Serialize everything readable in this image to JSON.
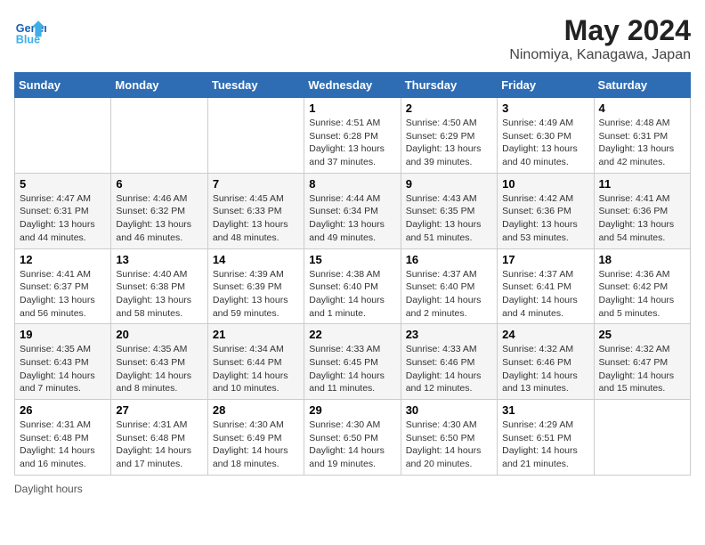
{
  "app": {
    "logo_line1": "General",
    "logo_line2": "Blue"
  },
  "header": {
    "title": "May 2024",
    "subtitle": "Ninomiya, Kanagawa, Japan"
  },
  "columns": [
    "Sunday",
    "Monday",
    "Tuesday",
    "Wednesday",
    "Thursday",
    "Friday",
    "Saturday"
  ],
  "footer": {
    "daylight_label": "Daylight hours"
  },
  "weeks": [
    {
      "days": [
        {
          "num": "",
          "sunrise": "",
          "sunset": "",
          "daylight": "",
          "empty": true
        },
        {
          "num": "",
          "sunrise": "",
          "sunset": "",
          "daylight": "",
          "empty": true
        },
        {
          "num": "",
          "sunrise": "",
          "sunset": "",
          "daylight": "",
          "empty": true
        },
        {
          "num": "1",
          "sunrise": "Sunrise: 4:51 AM",
          "sunset": "Sunset: 6:28 PM",
          "daylight": "Daylight: 13 hours and 37 minutes."
        },
        {
          "num": "2",
          "sunrise": "Sunrise: 4:50 AM",
          "sunset": "Sunset: 6:29 PM",
          "daylight": "Daylight: 13 hours and 39 minutes."
        },
        {
          "num": "3",
          "sunrise": "Sunrise: 4:49 AM",
          "sunset": "Sunset: 6:30 PM",
          "daylight": "Daylight: 13 hours and 40 minutes."
        },
        {
          "num": "4",
          "sunrise": "Sunrise: 4:48 AM",
          "sunset": "Sunset: 6:31 PM",
          "daylight": "Daylight: 13 hours and 42 minutes."
        }
      ]
    },
    {
      "days": [
        {
          "num": "5",
          "sunrise": "Sunrise: 4:47 AM",
          "sunset": "Sunset: 6:31 PM",
          "daylight": "Daylight: 13 hours and 44 minutes."
        },
        {
          "num": "6",
          "sunrise": "Sunrise: 4:46 AM",
          "sunset": "Sunset: 6:32 PM",
          "daylight": "Daylight: 13 hours and 46 minutes."
        },
        {
          "num": "7",
          "sunrise": "Sunrise: 4:45 AM",
          "sunset": "Sunset: 6:33 PM",
          "daylight": "Daylight: 13 hours and 48 minutes."
        },
        {
          "num": "8",
          "sunrise": "Sunrise: 4:44 AM",
          "sunset": "Sunset: 6:34 PM",
          "daylight": "Daylight: 13 hours and 49 minutes."
        },
        {
          "num": "9",
          "sunrise": "Sunrise: 4:43 AM",
          "sunset": "Sunset: 6:35 PM",
          "daylight": "Daylight: 13 hours and 51 minutes."
        },
        {
          "num": "10",
          "sunrise": "Sunrise: 4:42 AM",
          "sunset": "Sunset: 6:36 PM",
          "daylight": "Daylight: 13 hours and 53 minutes."
        },
        {
          "num": "11",
          "sunrise": "Sunrise: 4:41 AM",
          "sunset": "Sunset: 6:36 PM",
          "daylight": "Daylight: 13 hours and 54 minutes."
        }
      ]
    },
    {
      "days": [
        {
          "num": "12",
          "sunrise": "Sunrise: 4:41 AM",
          "sunset": "Sunset: 6:37 PM",
          "daylight": "Daylight: 13 hours and 56 minutes."
        },
        {
          "num": "13",
          "sunrise": "Sunrise: 4:40 AM",
          "sunset": "Sunset: 6:38 PM",
          "daylight": "Daylight: 13 hours and 58 minutes."
        },
        {
          "num": "14",
          "sunrise": "Sunrise: 4:39 AM",
          "sunset": "Sunset: 6:39 PM",
          "daylight": "Daylight: 13 hours and 59 minutes."
        },
        {
          "num": "15",
          "sunrise": "Sunrise: 4:38 AM",
          "sunset": "Sunset: 6:40 PM",
          "daylight": "Daylight: 14 hours and 1 minute."
        },
        {
          "num": "16",
          "sunrise": "Sunrise: 4:37 AM",
          "sunset": "Sunset: 6:40 PM",
          "daylight": "Daylight: 14 hours and 2 minutes."
        },
        {
          "num": "17",
          "sunrise": "Sunrise: 4:37 AM",
          "sunset": "Sunset: 6:41 PM",
          "daylight": "Daylight: 14 hours and 4 minutes."
        },
        {
          "num": "18",
          "sunrise": "Sunrise: 4:36 AM",
          "sunset": "Sunset: 6:42 PM",
          "daylight": "Daylight: 14 hours and 5 minutes."
        }
      ]
    },
    {
      "days": [
        {
          "num": "19",
          "sunrise": "Sunrise: 4:35 AM",
          "sunset": "Sunset: 6:43 PM",
          "daylight": "Daylight: 14 hours and 7 minutes."
        },
        {
          "num": "20",
          "sunrise": "Sunrise: 4:35 AM",
          "sunset": "Sunset: 6:43 PM",
          "daylight": "Daylight: 14 hours and 8 minutes."
        },
        {
          "num": "21",
          "sunrise": "Sunrise: 4:34 AM",
          "sunset": "Sunset: 6:44 PM",
          "daylight": "Daylight: 14 hours and 10 minutes."
        },
        {
          "num": "22",
          "sunrise": "Sunrise: 4:33 AM",
          "sunset": "Sunset: 6:45 PM",
          "daylight": "Daylight: 14 hours and 11 minutes."
        },
        {
          "num": "23",
          "sunrise": "Sunrise: 4:33 AM",
          "sunset": "Sunset: 6:46 PM",
          "daylight": "Daylight: 14 hours and 12 minutes."
        },
        {
          "num": "24",
          "sunrise": "Sunrise: 4:32 AM",
          "sunset": "Sunset: 6:46 PM",
          "daylight": "Daylight: 14 hours and 13 minutes."
        },
        {
          "num": "25",
          "sunrise": "Sunrise: 4:32 AM",
          "sunset": "Sunset: 6:47 PM",
          "daylight": "Daylight: 14 hours and 15 minutes."
        }
      ]
    },
    {
      "days": [
        {
          "num": "26",
          "sunrise": "Sunrise: 4:31 AM",
          "sunset": "Sunset: 6:48 PM",
          "daylight": "Daylight: 14 hours and 16 minutes."
        },
        {
          "num": "27",
          "sunrise": "Sunrise: 4:31 AM",
          "sunset": "Sunset: 6:48 PM",
          "daylight": "Daylight: 14 hours and 17 minutes."
        },
        {
          "num": "28",
          "sunrise": "Sunrise: 4:30 AM",
          "sunset": "Sunset: 6:49 PM",
          "daylight": "Daylight: 14 hours and 18 minutes."
        },
        {
          "num": "29",
          "sunrise": "Sunrise: 4:30 AM",
          "sunset": "Sunset: 6:50 PM",
          "daylight": "Daylight: 14 hours and 19 minutes."
        },
        {
          "num": "30",
          "sunrise": "Sunrise: 4:30 AM",
          "sunset": "Sunset: 6:50 PM",
          "daylight": "Daylight: 14 hours and 20 minutes."
        },
        {
          "num": "31",
          "sunrise": "Sunrise: 4:29 AM",
          "sunset": "Sunset: 6:51 PM",
          "daylight": "Daylight: 14 hours and 21 minutes."
        },
        {
          "num": "",
          "sunrise": "",
          "sunset": "",
          "daylight": "",
          "empty": true
        }
      ]
    }
  ]
}
